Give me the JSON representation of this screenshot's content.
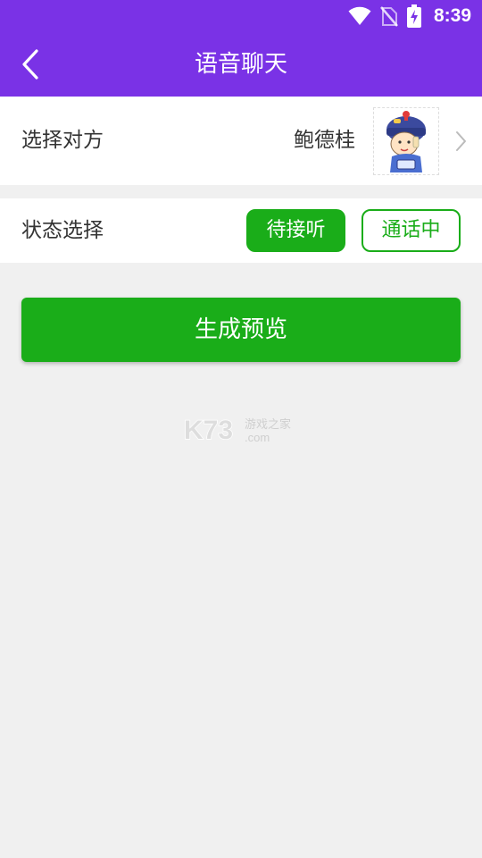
{
  "status_bar": {
    "time": "8:39",
    "icons": [
      "wifi-icon",
      "no-sim-icon",
      "battery-charging-icon"
    ]
  },
  "header": {
    "title": "语音聊天",
    "back_icon": "chevron-left-icon",
    "color": "#7a32e6"
  },
  "partner_row": {
    "label": "选择对方",
    "name": "鲍德桂",
    "avatar_icon": "cartoon-avatar-icon",
    "chevron_icon": "chevron-right-icon"
  },
  "status_row": {
    "label": "状态选择",
    "options": [
      "待接听",
      "通话中"
    ],
    "selected": "待接听",
    "accent_color": "#1aad19"
  },
  "generate_button": {
    "label": "生成预览"
  },
  "watermark": {
    "brand": "K73",
    "tagline": "游戏之家",
    "domain": ".com"
  },
  "colors": {
    "background": "#f0f0f0",
    "green": "#1aad19",
    "purple": "#7a32e6"
  }
}
